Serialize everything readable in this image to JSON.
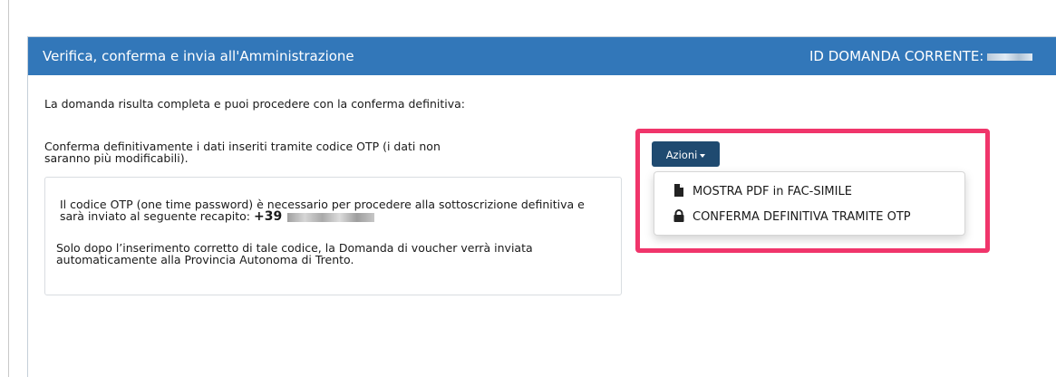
{
  "panel": {
    "title": "Verifica, conferma e invia all'Amministrazione",
    "id_label": "ID DOMANDA CORRENTE:",
    "header_color": "#3277b9"
  },
  "content": {
    "intro": "La domanda risulta completa e puoi procedere con la conferma definitiva:",
    "confirm_text": "Conferma definitivamente i dati inseriti tramite codice OTP (i dati non saranno più modificabili).",
    "otp_line1_text": "Il codice OTP (one time password) è necessario per procedere alla sottoscrizione definitiva e sarà inviato al seguente recapito:",
    "phone_prefix": "+39",
    "otp_line2_text": "Solo dopo l’inserimento corretto di tale codice, la Domanda di voucher verrà inviata automaticamente alla Provincia Autonoma di Trento."
  },
  "actions": {
    "button_label": "Azioni",
    "button_color": "#1f4a70",
    "highlight_color": "#f0356b",
    "menu_items": [
      {
        "label": "MOSTRA PDF in FAC-SIMILE",
        "icon": "file-icon"
      },
      {
        "label": "CONFERMA DEFINITIVA TRAMITE OTP",
        "icon": "lock-icon"
      }
    ]
  }
}
